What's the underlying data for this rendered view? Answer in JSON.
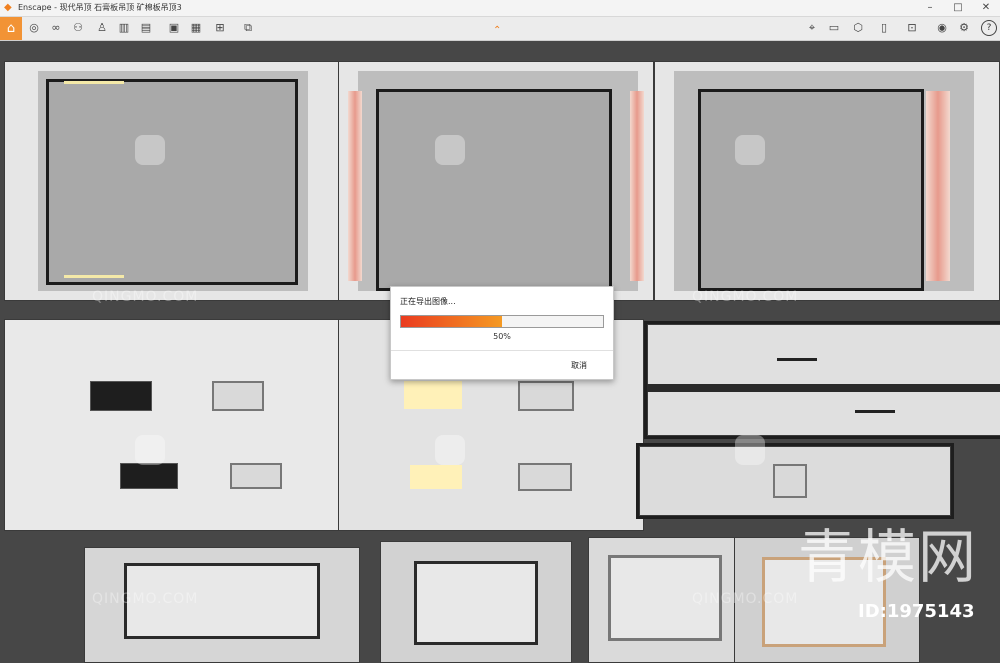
{
  "window": {
    "app_name": "Enscape",
    "title": "Enscape - 现代吊顶 石膏板吊顶 矿棉板吊顶3"
  },
  "toolbar": {
    "icons": [
      "home-icon",
      "camera-icon",
      "binoculars-icon",
      "walk-icon",
      "person-icon",
      "building-icon",
      "clapper-icon",
      "export-image-icon",
      "export-panorama-icon",
      "batch-render-icon",
      "export-video-icon",
      "asset-library-icon",
      "materials-icon",
      "cube-icon",
      "book-icon",
      "capture-icon",
      "eye-icon",
      "settings-icon",
      "help-icon"
    ],
    "help_label": "?"
  },
  "dialog": {
    "title": "正在导出图像...",
    "progress": 0.5,
    "progress_text": "50%",
    "cancel_label": "取消"
  },
  "watermark": {
    "text": "QINGMO.COM",
    "brand": "青模网",
    "image_id": "ID:1975143"
  },
  "colors": {
    "progress_start": "#ea3b1f",
    "progress_end": "#f59a23",
    "home_accent": "#f29335"
  }
}
